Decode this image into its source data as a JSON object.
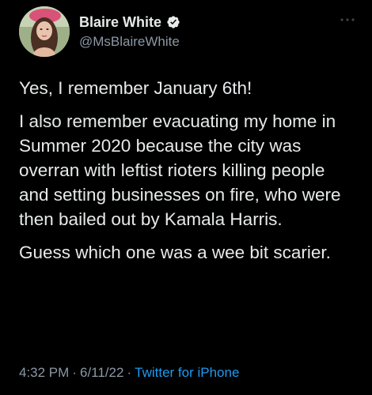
{
  "author": {
    "display_name": "Blaire White",
    "handle": "@MsBlaireWhite",
    "verified": true
  },
  "icons": {
    "verified": "verified-badge-icon",
    "more": "more-horizontal-icon"
  },
  "colors": {
    "background": "#000000",
    "text": "#e7e9ea",
    "secondary": "#8b98a5",
    "link": "#1d9bf0"
  },
  "tweet": {
    "paragraphs": [
      "Yes, I remember January 6th!",
      "I also remember evacuating my home in Summer 2020 because the city was overran with leftist rioters killing people and setting businesses on fire, who were then bailed out by Kamala Harris.",
      "Guess which one was a wee bit scarier."
    ]
  },
  "meta": {
    "time": "4:32 PM",
    "date": "6/11/22",
    "separator": "·",
    "source": "Twitter for iPhone"
  }
}
